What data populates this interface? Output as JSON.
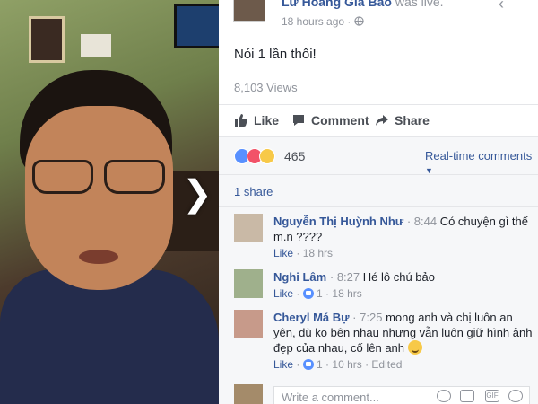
{
  "post": {
    "author": "Lư Hoàng Gia Bảo",
    "status": "was live.",
    "time": "18 hours ago",
    "privacy_icon": "globe-icon",
    "text": "Nói 1 lần thôi!",
    "views": "8,103 Views"
  },
  "actions": {
    "like": "Like",
    "comment": "Comment",
    "share": "Share"
  },
  "reactions": {
    "count": "465",
    "icons": [
      "like-icon",
      "love-icon",
      "sad-icon"
    ],
    "colors": {
      "like": "#5890ff",
      "love": "#f25268",
      "sad": "#f7c948"
    }
  },
  "realtime_label": "Real-time comments",
  "share_count": "1 share",
  "comments": [
    {
      "name": "Nguyễn Thị Huỳnh Như",
      "time": "8:44",
      "text": "Có chuyện gì thế m.n ????",
      "like": "Like",
      "age": "18 hrs",
      "likes": ""
    },
    {
      "name": "Nghi Lâm",
      "time": "8:27",
      "text": "Hé lô chú bảo",
      "like": "Like",
      "likes": "1",
      "age": "18 hrs"
    },
    {
      "name": "Cheryl Má Bự",
      "time": "7:25",
      "text": "mong anh và chị luôn an yên, dù ko bên nhau nhưng vẫn luôn giữ hình ảnh đẹp của nhau, cố lên anh",
      "like": "Like",
      "likes": "1",
      "age": "10 hrs",
      "edited": "Edited"
    }
  ],
  "composer": {
    "placeholder": "Write a comment..."
  },
  "theme": {
    "link": "#365899",
    "muted": "#90949c",
    "text": "#1d2129"
  }
}
